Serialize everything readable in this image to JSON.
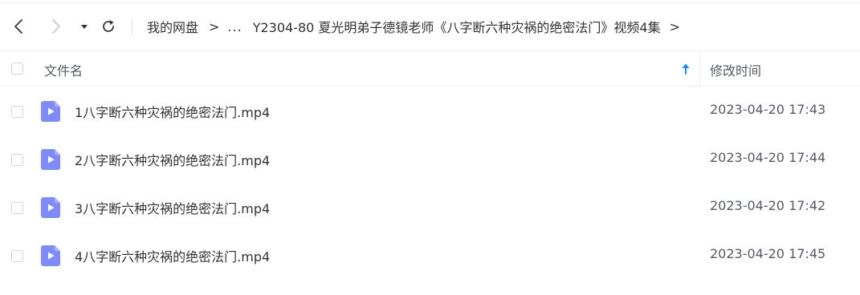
{
  "toolbar": {
    "back_icon": "chevron-left-icon",
    "forward_icon": "chevron-right-icon",
    "history_dropdown_icon": "caret-down-icon",
    "refresh_icon": "refresh-icon"
  },
  "breadcrumb": {
    "root": "我的网盘",
    "separator": ">",
    "ellipsis": "...",
    "current": "Y2304-80 夏光明弟子德镜老师《八字断六种灾祸的绝密法门》视频4集",
    "trailing": ">"
  },
  "table": {
    "header": {
      "name": "文件名",
      "time": "修改时间",
      "sort_icon": "sort-ascending-arrow-icon",
      "sort_color": "#1a8cff"
    },
    "rows": [
      {
        "name": "1八字断六种灾祸的绝密法门.mp4",
        "modified": "2023-04-20 17:43",
        "icon": "video-file-icon"
      },
      {
        "name": "2八字断六种灾祸的绝密法门.mp4",
        "modified": "2023-04-20 17:44",
        "icon": "video-file-icon"
      },
      {
        "name": "3八字断六种灾祸的绝密法门.mp4",
        "modified": "2023-04-20 17:42",
        "icon": "video-file-icon"
      },
      {
        "name": "4八字断六种灾祸的绝密法门.mp4",
        "modified": "2023-04-20 17:45",
        "icon": "video-file-icon"
      }
    ]
  },
  "colors": {
    "video_icon": "#7f8cf5",
    "text_primary": "#333333",
    "text_secondary": "#555a63"
  }
}
